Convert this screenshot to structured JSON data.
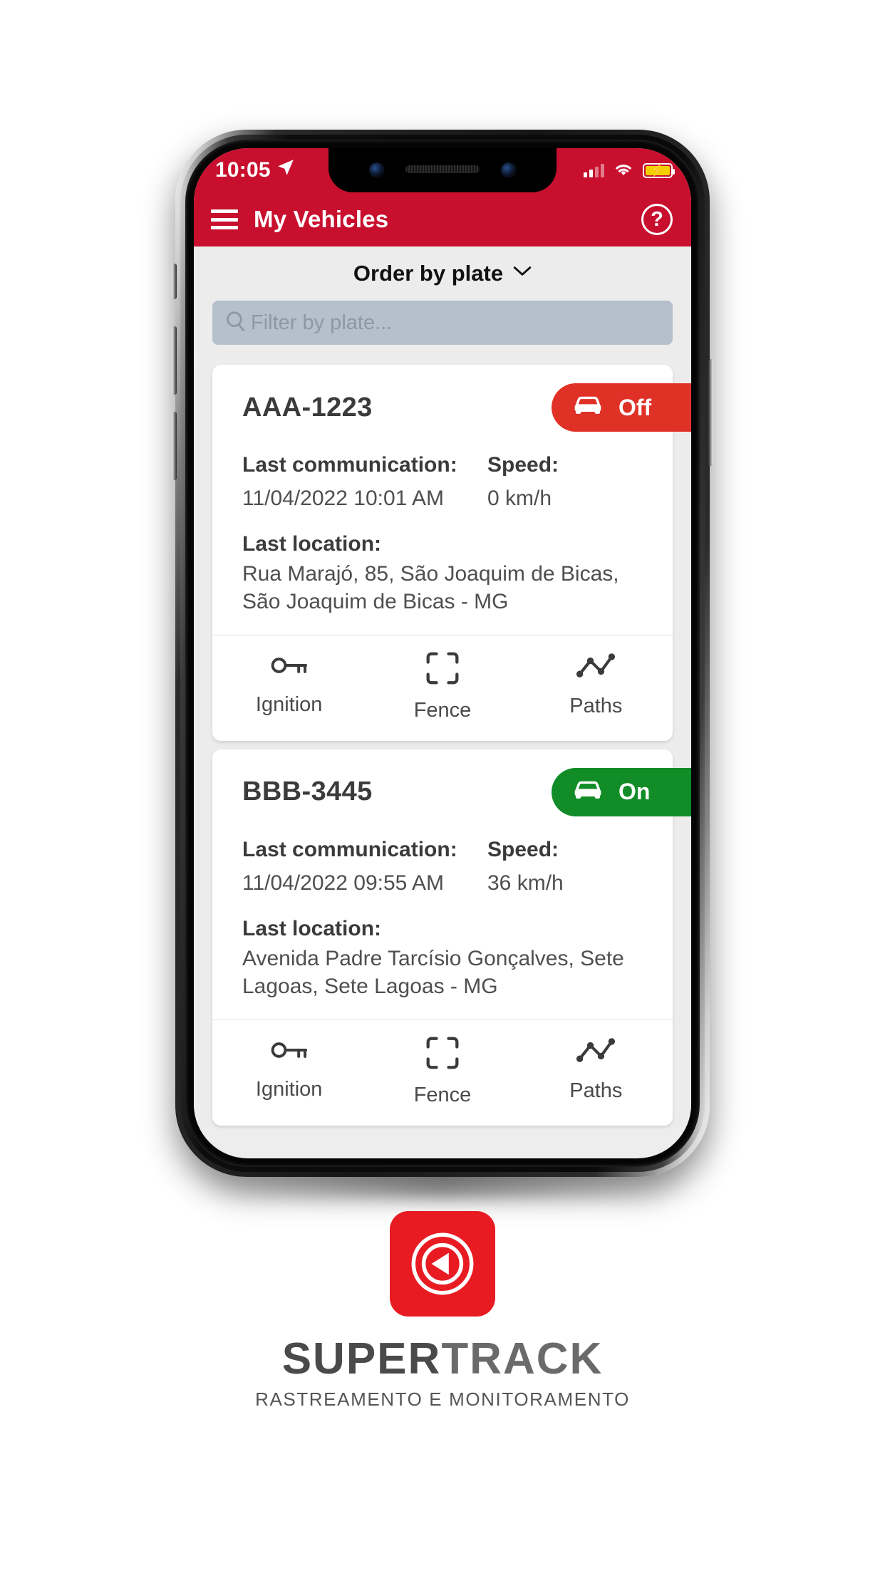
{
  "status_bar": {
    "time": "10:05",
    "location_icon": "navigation-arrow-icon",
    "signal_icon": "cellular-signal-icon",
    "wifi_icon": "wifi-icon",
    "battery_icon": "battery-charging-icon"
  },
  "app_bar": {
    "menu_icon": "hamburger-menu-icon",
    "title": "My Vehicles",
    "help_label": "?"
  },
  "sort_bar": {
    "label": "Order by plate",
    "chevron": "⌄"
  },
  "search": {
    "placeholder": "Filter by plate...",
    "value": "",
    "icon": "search-icon"
  },
  "colors": {
    "brand_red": "#C8102E",
    "badge_off": "#E03127",
    "badge_on": "#118C27",
    "page_bg": "#ECECEC",
    "card_bg": "#FFFFFF",
    "search_bg": "#B5C0CC",
    "logo_red": "#E81B23"
  },
  "labels": {
    "last_communication": "Last communication:",
    "speed": "Speed:",
    "last_location": "Last location:"
  },
  "actions": [
    {
      "id": "ignition",
      "label": "Ignition",
      "icon": "key-icon"
    },
    {
      "id": "fence",
      "label": "Fence",
      "icon": "fence-frame-icon"
    },
    {
      "id": "paths",
      "label": "Paths",
      "icon": "route-chart-icon"
    }
  ],
  "vehicles": [
    {
      "plate": "AAA-1223",
      "status": "Off",
      "status_kind": "off",
      "status_icon": "car-icon",
      "last_communication": "11/04/2022 10:01 AM",
      "speed": "0 km/h",
      "last_location": "Rua Marajó, 85, São Joaquim de Bicas, São Joaquim de Bicas - MG"
    },
    {
      "plate": "BBB-3445",
      "status": "On",
      "status_kind": "on",
      "status_icon": "car-icon",
      "last_communication": "11/04/2022 09:55 AM",
      "speed": "36 km/h",
      "last_location": "Avenida Padre Tarcísio Gonçalves, Sete Lagoas, Sete Lagoas - MG"
    }
  ],
  "branding": {
    "wordmark_bold": "SUPER",
    "wordmark_light": "TRACK",
    "tagline": "RASTREAMENTO E MONITORAMENTO",
    "mark_icon": "supertrack-radar-arrow-icon"
  }
}
